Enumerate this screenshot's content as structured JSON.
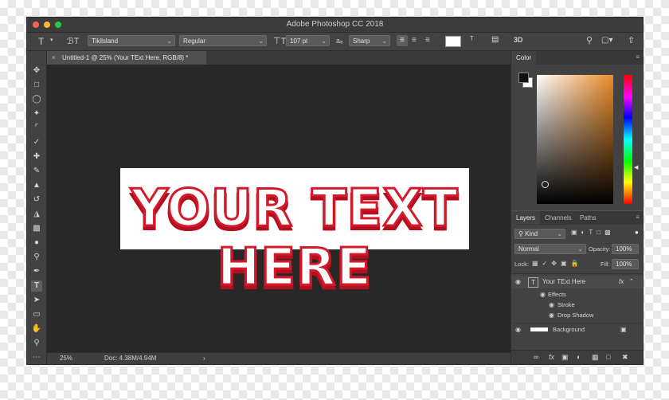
{
  "app": {
    "title": "Adobe Photoshop CC 2018"
  },
  "options_bar": {
    "tool_icon": "T",
    "orientation_icon": "text-orientation-icon",
    "font_family": "Tikilsland",
    "font_style": "Regular",
    "font_size": "107 pt",
    "aa_label": "aₐ",
    "anti_alias": "Sharp",
    "three_d": "3D"
  },
  "document": {
    "tab_title": "Untitled-1 @ 25% (Your TExt Here, RGB/8) *",
    "canvas_text": "YOUR TEXT HERE",
    "zoom": "25%",
    "doc_info": "Doc: 4.38M/4.94M"
  },
  "color_panel": {
    "title": "Color"
  },
  "layers_panel": {
    "tabs": [
      "Layers",
      "Channels",
      "Paths"
    ],
    "kind": "Kind",
    "blend_mode": "Normal",
    "opacity_label": "Opacity:",
    "opacity": "100%",
    "lock_label": "Lock:",
    "fill_label": "Fill:",
    "fill": "100%",
    "layers": [
      {
        "name": "Your TExt Here",
        "thumb": "T",
        "fx": "fx"
      },
      {
        "name": "Effects"
      },
      {
        "name": "Stroke"
      },
      {
        "name": "Drop Shadow"
      },
      {
        "name": "Background"
      }
    ]
  },
  "colors": {
    "accent_red": "#d6182b",
    "picker_orange": "#ec8b27"
  }
}
